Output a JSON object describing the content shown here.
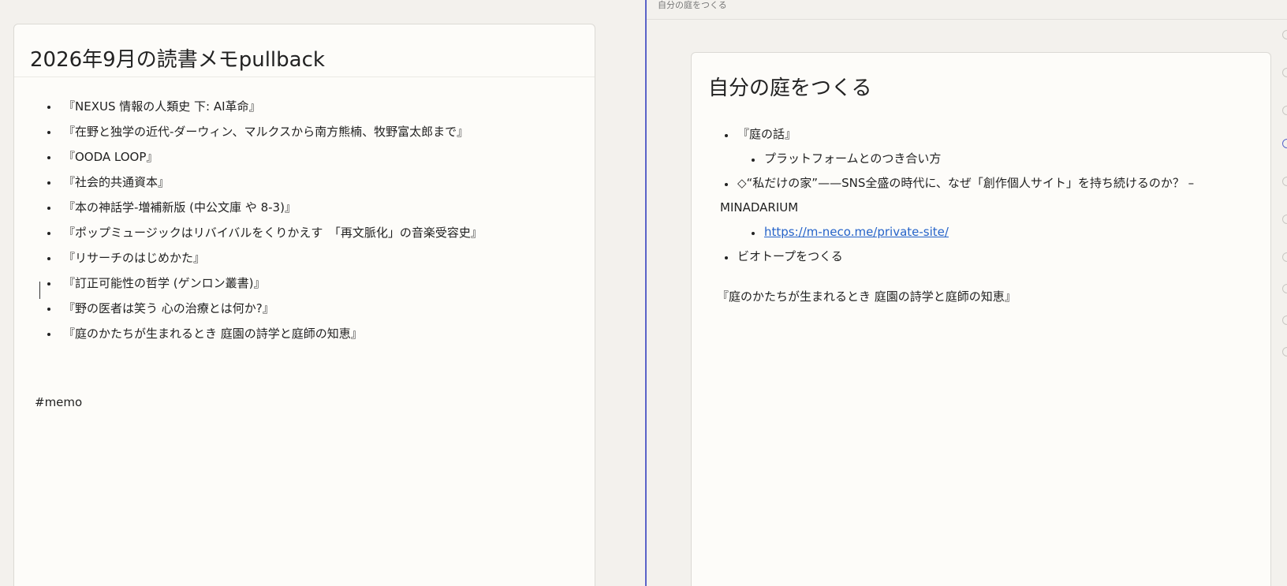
{
  "left_note": {
    "title": "2026年9月の読書メモpullback",
    "items": [
      "『NEXUS 情報の人類史 下: AI革命』",
      "『在野と独学の近代-ダーウィン、マルクスから南方熊楠、牧野富太郎まで』",
      "『OODA LOOP』",
      "『社会的共通資本』",
      "『本の神話学-増補新版 (中公文庫 や 8-3)』",
      "『ポップミュージックはリバイバルをくりかえす　「再文脈化」の音楽受容史』",
      "『リサーチのはじめかた』",
      "『訂正可能性の哲学 (ゲンロン叢書)』",
      "『野の医者は笑う 心の治療とは何か?』",
      "『庭のかたちが生まれるとき 庭園の詩学と庭師の知恵』"
    ],
    "tag": "#memo"
  },
  "right_note": {
    "header_title": "自分の庭をつくる",
    "title": "自分の庭をつくる",
    "item1": "『庭の話』",
    "item1_sub": "プラットフォームとのつき合い方",
    "item2_line1": "◇“私だけの家”——SNS全盛の時代に、なぜ「創作個人サイト」を持ち続けるのか？ –",
    "item2_line2": "MINADARIUM",
    "item2_link": "https://m-neco.me/private-site/",
    "item3": "ビオトープをつくる",
    "trailing": "『庭のかたちが生まれるとき 庭園の詩学と庭師の知恵』"
  },
  "colors": {
    "accent": "#5a63c8",
    "link": "#2563c9",
    "background": "#f3f1ed",
    "card": "#fdfcf9"
  }
}
